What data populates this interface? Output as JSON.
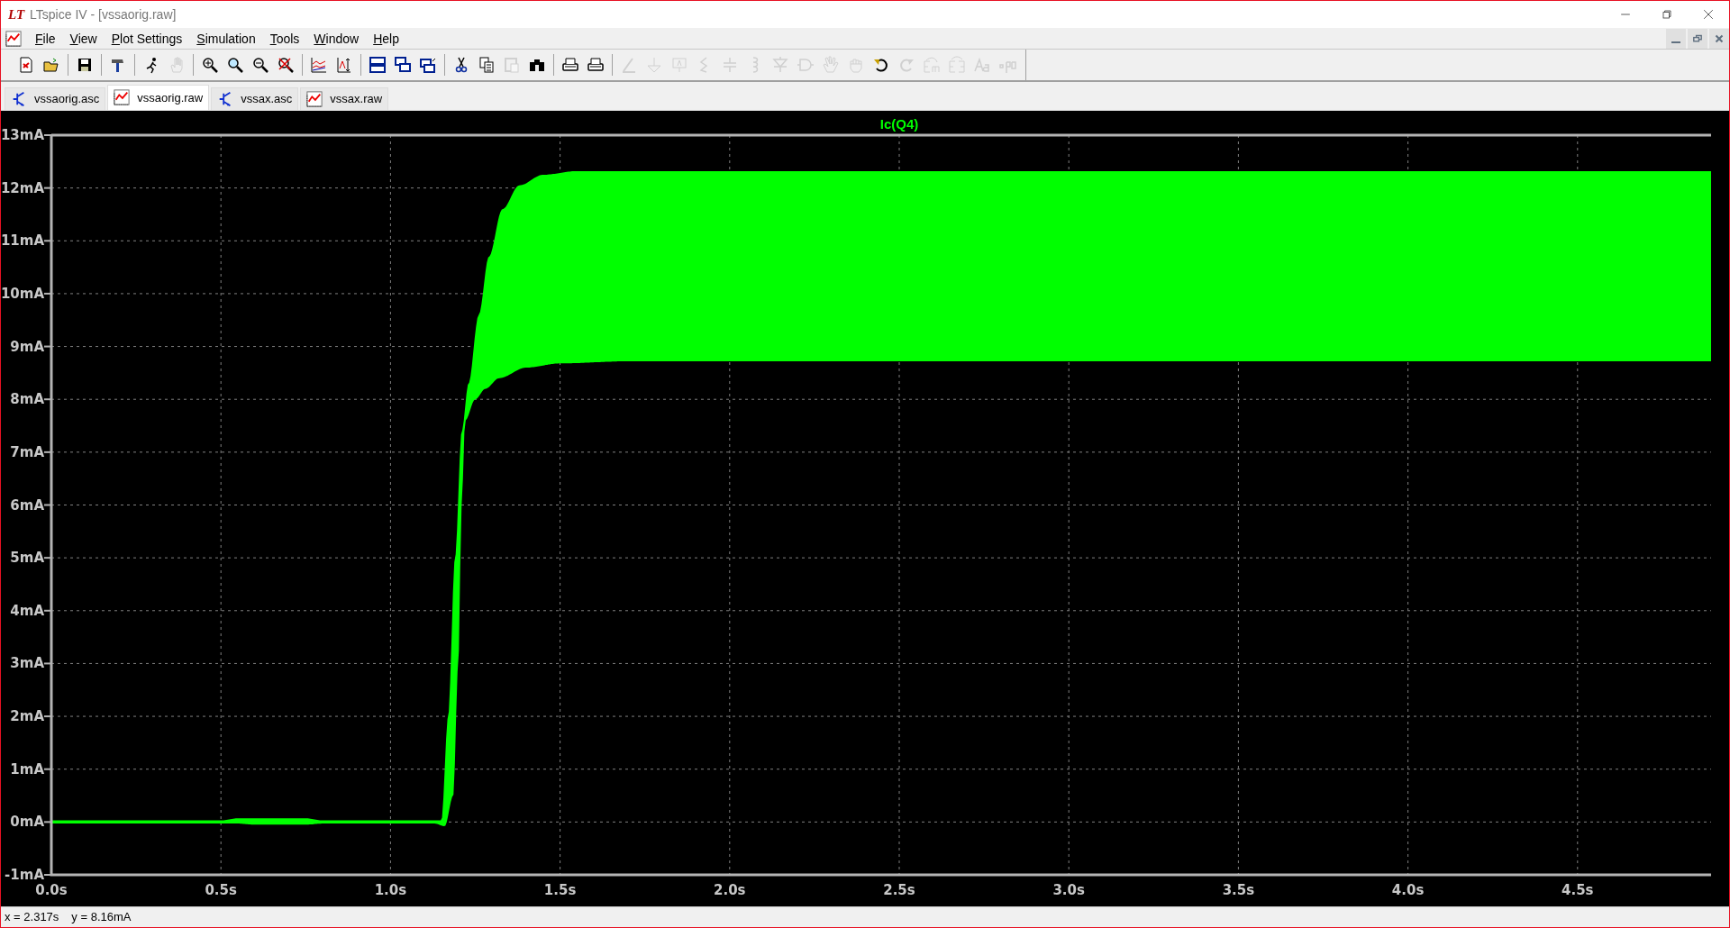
{
  "window": {
    "logo": "LT",
    "title": "LTspice IV - [vssaorig.raw]"
  },
  "menu": [
    "File",
    "View",
    "Plot Settings",
    "Simulation",
    "Tools",
    "Window",
    "Help"
  ],
  "toolbar": [
    {
      "disabled": false
    },
    {
      "disabled": false
    },
    {
      "disabled": false
    },
    {
      "disabled": false
    },
    {
      "disabled": false
    },
    {
      "disabled": true
    },
    {
      "disabled": false
    },
    {
      "disabled": false
    },
    {
      "disabled": false
    },
    {
      "disabled": false
    },
    {
      "disabled": false
    },
    {
      "disabled": false
    },
    {
      "disabled": false
    },
    {
      "disabled": false
    },
    {
      "disabled": false
    },
    {
      "disabled": false
    },
    {
      "disabled": false
    },
    {
      "disabled": true
    },
    {
      "disabled": false
    },
    {
      "disabled": false
    },
    {
      "disabled": false
    },
    {
      "disabled": true
    },
    {
      "disabled": true
    },
    {
      "disabled": true
    },
    {
      "disabled": true
    },
    {
      "disabled": true
    },
    {
      "disabled": true
    },
    {
      "disabled": true
    },
    {
      "disabled": true
    },
    {
      "disabled": true
    },
    {
      "disabled": true
    },
    {
      "disabled": false
    },
    {
      "disabled": true
    },
    {
      "disabled": true
    },
    {
      "disabled": true
    },
    {
      "disabled": true
    },
    {
      "disabled": true
    }
  ],
  "tabs": [
    {
      "label": "vssaorig.asc",
      "kind": "schematic",
      "selected": false
    },
    {
      "label": "vssaorig.raw",
      "kind": "waveform",
      "selected": true
    },
    {
      "label": "vssax.asc",
      "kind": "schematic",
      "selected": false
    },
    {
      "label": "vssax.raw",
      "kind": "waveform",
      "selected": false
    }
  ],
  "plot": {
    "trace_label": "Ic(Q4)",
    "y_ticks": [
      "13mA",
      "12mA",
      "11mA",
      "10mA",
      "9mA",
      "8mA",
      "7mA",
      "6mA",
      "5mA",
      "4mA",
      "3mA",
      "2mA",
      "1mA",
      "0mA",
      "-1mA"
    ],
    "x_ticks": [
      "0.0s",
      "0.5s",
      "1.0s",
      "1.5s",
      "2.0s",
      "2.5s",
      "3.0s",
      "3.5s",
      "4.0s",
      "4.5s"
    ]
  },
  "status_bar": {
    "x_reading": "x = 2.317s",
    "y_reading": "y = 8.16mA"
  }
}
